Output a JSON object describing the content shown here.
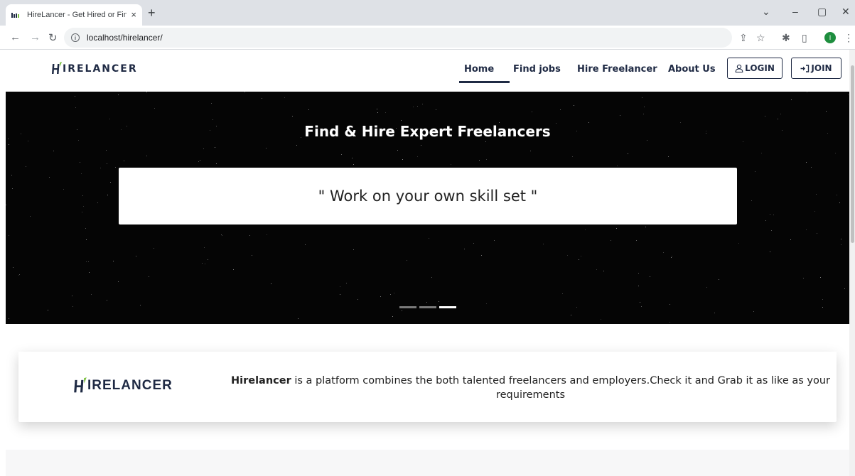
{
  "browser": {
    "tab_title": "HireLancer - Get Hired or Find Em",
    "tab_close": "×",
    "new_tab": "+",
    "url": "localhost/hirelancer/",
    "info_glyph": "i",
    "profile_initial": "I",
    "icons": [
      "back-icon",
      "forward-icon",
      "reload-icon",
      "info-icon",
      "share-icon",
      "star-icon",
      "extensions-icon",
      "side-panel-icon",
      "menu-icon"
    ]
  },
  "nav": {
    "logo_text": "IRELANCER",
    "links": [
      "Home",
      "Find jobs",
      "Hire Freelancer",
      "About Us"
    ],
    "active_link": "Home",
    "login_label": "LOGIN",
    "join_label": "JOIN"
  },
  "hero": {
    "title": "Find & Hire Expert Freelancers",
    "quote": "\" Work on your own skill set \"",
    "slides_count": 3,
    "active_slide": 3
  },
  "about": {
    "logo_text": "IRELANCER",
    "brand": "Hirelancer",
    "description": " is a platform combines the both talented freelancers and employers.Check it and Grab it as like as your requirements"
  },
  "colors": {
    "brand_navy": "#1f2a44",
    "brand_green": "#7cc142",
    "hero_bg": "#050505"
  }
}
